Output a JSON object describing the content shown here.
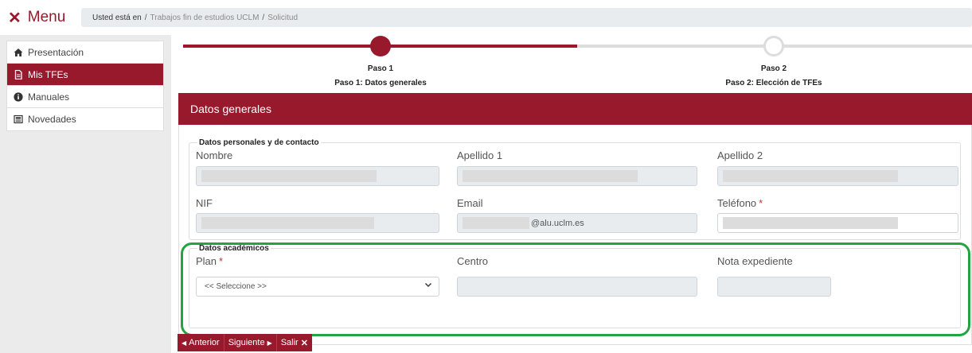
{
  "header": {
    "menu_label": "Menu",
    "breadcrumb": {
      "lead": "Usted está en",
      "items": [
        "Trabajos fin de estudios UCLM",
        "Solicitud"
      ]
    }
  },
  "sidebar": {
    "items": [
      {
        "label": "Presentación",
        "icon": "home-icon"
      },
      {
        "label": "Mis TFEs",
        "icon": "document-icon",
        "active": true
      },
      {
        "label": "Manuales",
        "icon": "info-icon"
      },
      {
        "label": "Novedades",
        "icon": "newspaper-icon"
      }
    ]
  },
  "stepper": {
    "steps": [
      {
        "title": "Paso 1",
        "subtitle": "Paso 1: Datos generales",
        "state": "active"
      },
      {
        "title": "Paso 2",
        "subtitle": "Paso 2: Elección de TFEs",
        "state": "pending"
      }
    ]
  },
  "panel": {
    "title": "Datos generales",
    "personal": {
      "legend": "Datos personales y de contacto",
      "nombre": "Nombre",
      "apellido1": "Apellido 1",
      "apellido2": "Apellido 2",
      "nif": "NIF",
      "email": "Email",
      "email_value": "@alu.uclm.es",
      "telefono": "Teléfono",
      "required_mark": "*"
    },
    "academic": {
      "legend": "Datos académicos",
      "plan": "Plan",
      "plan_select": "<< Seleccione >>",
      "centro": "Centro",
      "nota": "Nota expediente",
      "required_mark": "*"
    }
  },
  "actions": {
    "anterior": "Anterior",
    "siguiente": "Siguiente",
    "salir": "Salir"
  },
  "colors": {
    "brand": "#98182c",
    "highlight": "#21a441",
    "field_disabled": "#e9ecef"
  }
}
